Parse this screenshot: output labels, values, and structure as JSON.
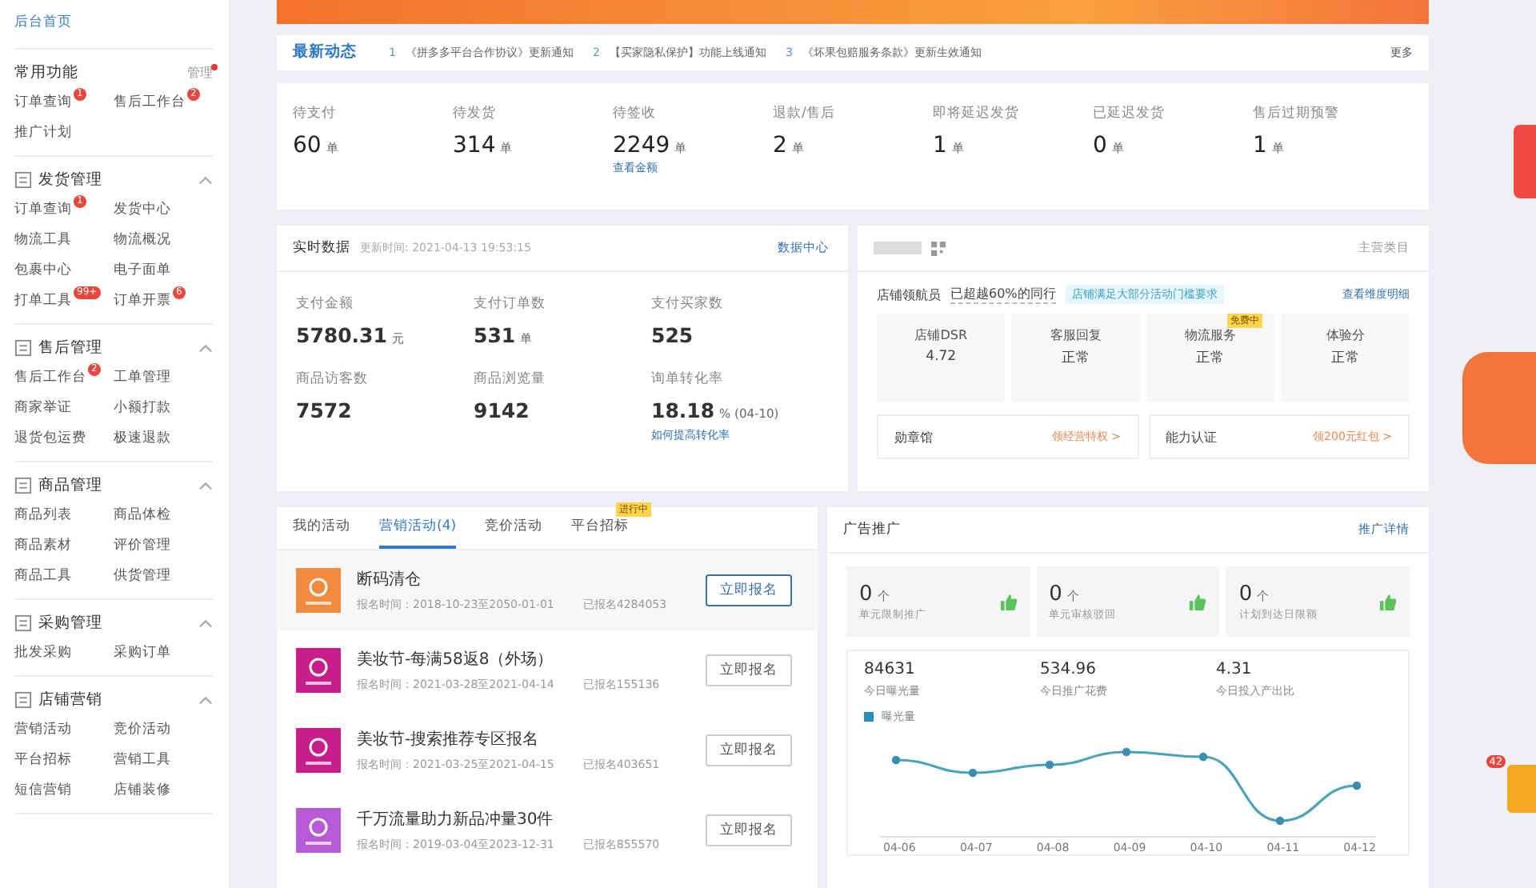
{
  "sidebar": {
    "home_link": "后台首页",
    "sections": [
      {
        "kind": "common",
        "title": "常用功能",
        "manage_link": "管理",
        "items": [
          {
            "label": "订单查询",
            "badge": "1"
          },
          {
            "label": "售后工作台",
            "badge": "2"
          },
          {
            "label": "推广计划"
          }
        ]
      },
      {
        "kind": "group",
        "title": "发货管理",
        "expanded": true,
        "items": [
          {
            "label": "订单查询",
            "badge": "1"
          },
          {
            "label": "发货中心"
          },
          {
            "label": "物流工具"
          },
          {
            "label": "物流概况"
          },
          {
            "label": "包裹中心"
          },
          {
            "label": "电子面单"
          },
          {
            "label": "打单工具",
            "badge": "99+"
          },
          {
            "label": "订单开票",
            "badge": "6"
          }
        ]
      },
      {
        "kind": "group",
        "title": "售后管理",
        "expanded": true,
        "items": [
          {
            "label": "售后工作台",
            "badge": "2"
          },
          {
            "label": "工单管理"
          },
          {
            "label": "商家举证"
          },
          {
            "label": "小额打款"
          },
          {
            "label": "退货包运费"
          },
          {
            "label": "极速退款"
          }
        ]
      },
      {
        "kind": "group",
        "title": "商品管理",
        "expanded": true,
        "items": [
          {
            "label": "商品列表"
          },
          {
            "label": "商品体检"
          },
          {
            "label": "商品素材"
          },
          {
            "label": "评价管理"
          },
          {
            "label": "商品工具"
          },
          {
            "label": "供货管理"
          }
        ]
      },
      {
        "kind": "group",
        "title": "采购管理",
        "expanded": true,
        "items": [
          {
            "label": "批发采购"
          },
          {
            "label": "采购订单"
          }
        ]
      },
      {
        "kind": "group",
        "title": "店铺营销",
        "expanded": true,
        "items": [
          {
            "label": "营销活动"
          },
          {
            "label": "竞价活动"
          },
          {
            "label": "平台招标"
          },
          {
            "label": "营销工具"
          },
          {
            "label": "短信营销"
          },
          {
            "label": "店铺装修"
          }
        ]
      }
    ]
  },
  "news": {
    "title": "最新动态",
    "items": [
      {
        "index": "1",
        "text": "《拼多多平台合作协议》更新通知"
      },
      {
        "index": "2",
        "text": "【买家隐私保护】功能上线通知"
      },
      {
        "index": "3",
        "text": "《坏果包赔服务条款》更新生效通知"
      }
    ],
    "more": "更多"
  },
  "order_stats": [
    {
      "label": "待支付",
      "value": "60",
      "unit": "单"
    },
    {
      "label": "待发货",
      "value": "314",
      "unit": "单"
    },
    {
      "label": "待签收",
      "value": "2249",
      "unit": "单",
      "link": "查看金额"
    },
    {
      "label": "退款/售后",
      "value": "2",
      "unit": "单"
    },
    {
      "label": "即将延迟发货",
      "value": "1",
      "unit": "单"
    },
    {
      "label": "已延迟发货",
      "value": "0",
      "unit": "单"
    },
    {
      "label": "售后过期预警",
      "value": "1",
      "unit": "单"
    }
  ],
  "realtime": {
    "title": "实时数据",
    "updated": "更新时间: 2021-04-13 19:53:15",
    "link": "数据中心",
    "metrics": [
      {
        "label": "支付金额",
        "value": "5780.31",
        "unit": "元"
      },
      {
        "label": "支付订单数",
        "value": "531",
        "unit": "单"
      },
      {
        "label": "支付买家数",
        "value": "525"
      },
      {
        "label": "商品访客数",
        "value": "7572"
      },
      {
        "label": "商品浏览量",
        "value": "9142"
      },
      {
        "label": "询单转化率",
        "value": "18.18",
        "unit": "% (04-10)",
        "link": "如何提高转化率"
      }
    ]
  },
  "store": {
    "category_link": "主营类目",
    "rank_label": "店铺领航员",
    "rank_text": "已超越60%的同行",
    "tag": "店铺满足大部分活动门槛要求",
    "detail_link": "查看维度明细",
    "metrics": [
      {
        "label": "店铺DSR",
        "value": "4.72"
      },
      {
        "label": "客服回复",
        "value": "正常"
      },
      {
        "label": "物流服务",
        "value": "正常",
        "badge": "免费中"
      },
      {
        "label": "体验分",
        "value": "正常"
      }
    ],
    "links": [
      {
        "label": "勋章馆",
        "action": "领经营特权 >"
      },
      {
        "label": "能力认证",
        "action": "领200元红包 >"
      }
    ]
  },
  "activities": {
    "tabs": [
      {
        "label": "我的活动",
        "selected": false
      },
      {
        "label": "营销活动(4)",
        "selected": true
      },
      {
        "label": "竞价活动",
        "selected": false
      },
      {
        "label": "平台招标",
        "selected": false,
        "badge": "进行中"
      }
    ],
    "items": [
      {
        "title": "断码清仓",
        "period": "报名时间：2018-10-23至2050-01-01",
        "count": "已报名4284053",
        "button": "立即报名",
        "color": "#f08a3c",
        "highlighted": true
      },
      {
        "title": "美妆节-每满58返8（外场）",
        "period": "报名时间：2021-03-28至2021-04-14",
        "count": "已报名155136",
        "button": "立即报名",
        "color": "#c81e8c",
        "highlighted": false
      },
      {
        "title": "美妆节-搜索推荐专区报名",
        "period": "报名时间：2021-03-25至2021-04-15",
        "count": "已报名403651",
        "button": "立即报名",
        "color": "#c81e8c",
        "highlighted": false
      },
      {
        "title": "千万流量助力新品冲量30件",
        "period": "报名时间：2019-03-04至2023-12-31",
        "count": "已报名855570",
        "button": "立即报名",
        "color": "#b65ad8",
        "highlighted": false
      }
    ]
  },
  "ads": {
    "title": "广告推广",
    "link": "推广详情",
    "alerts": [
      {
        "value": "0",
        "unit": "个",
        "label": "单元限制推广"
      },
      {
        "value": "0",
        "unit": "个",
        "label": "单元审核驳回"
      },
      {
        "value": "0",
        "unit": "个",
        "label": "计划到达日限额"
      }
    ],
    "today": [
      {
        "value": "84631",
        "label": "今日曝光量"
      },
      {
        "value": "534.96",
        "label": "今日推广花费"
      },
      {
        "value": "4.31",
        "label": "今日投入产出比"
      }
    ],
    "chart": {
      "legend": "曝光量",
      "x_labels": [
        "04-06",
        "04-07",
        "04-08",
        "04-09",
        "04-10",
        "04-11",
        "04-12"
      ]
    }
  },
  "float_badge": "42"
}
